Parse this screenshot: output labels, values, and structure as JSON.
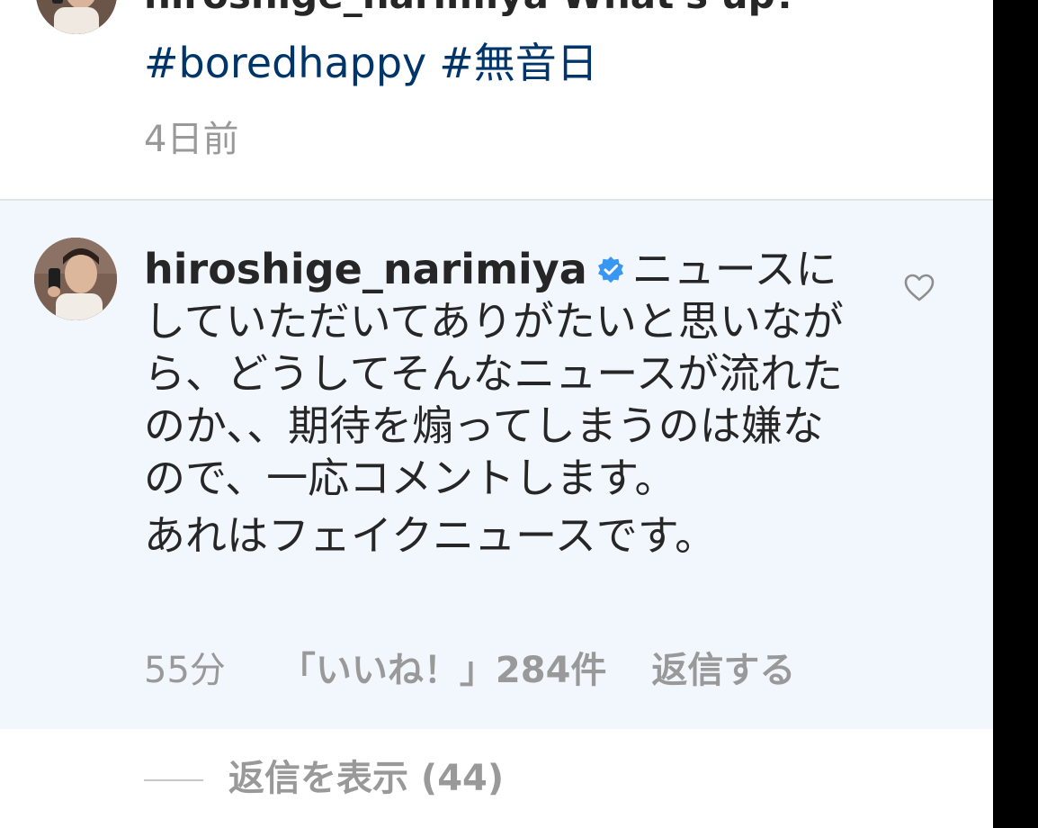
{
  "top_comment": {
    "text": "hiroshige_narimiya  What's up?",
    "hashtags": [
      "#boredhappy",
      "#無音日"
    ],
    "time": "4日前"
  },
  "highlighted_comment": {
    "username": "hiroshige_narimiya",
    "verified_icon": "verified-badge-icon",
    "text_part1": "ニュースにしていただいてありがたいと思いながら、どうしてそんなニュースが流れたのか、、期待を煽ってしまうのは嫌なので、一応コメントします。",
    "text_part2": "あれはフェイクニュースです。",
    "time": "55分",
    "likes": "「いいね！」284件",
    "reply_label": "返信する",
    "like_icon": "heart-outline-icon"
  },
  "view_replies": {
    "label": "返信を表示 (44)"
  },
  "colors": {
    "text": "#262626",
    "hashtag": "#003569",
    "secondary": "#999999",
    "highlight_bg": "#f2f7fd",
    "verified_blue": "#3897f0"
  }
}
